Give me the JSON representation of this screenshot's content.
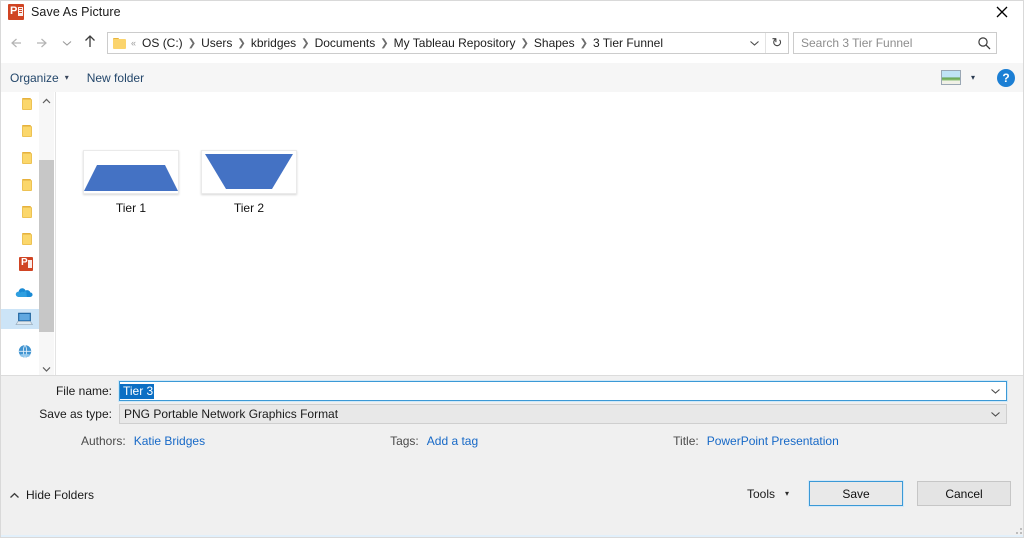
{
  "window": {
    "title": "Save As Picture",
    "app_icon": "powerpoint-icon",
    "close_label": "✕"
  },
  "nav": {
    "back_icon": "arrow-left-icon",
    "forward_icon": "arrow-right-icon",
    "recent_icon": "chevron-down-icon",
    "up_icon": "arrow-up-icon",
    "folder_icon": "folder-icon",
    "path_separator_small": "«",
    "breadcrumbs": [
      "OS (C:)",
      "Users",
      "kbridges",
      "Documents",
      "My Tableau Repository",
      "Shapes",
      "3 Tier Funnel"
    ],
    "breadcrumb_separator": "❯",
    "address_chevron_icon": "chevron-down-icon",
    "refresh_icon": "refresh-icon",
    "refresh_glyph": "↻"
  },
  "search": {
    "placeholder": "Search 3 Tier Funnel",
    "value": "",
    "icon": "search-icon"
  },
  "toolbar": {
    "organize_label": "Organize",
    "organize_caret": "▾",
    "new_folder_label": "New folder",
    "view_icon": "view-picture-icon",
    "view_caret": "▾",
    "help_label": "?"
  },
  "sidebar": {
    "scroll_up_icon": "chevron-up-icon",
    "scroll_down_icon": "chevron-down-icon",
    "items": [
      {
        "icon": "folder-icon",
        "name": "folder-item-1",
        "selected": false
      },
      {
        "icon": "folder-icon",
        "name": "folder-item-2",
        "selected": false
      },
      {
        "icon": "folder-icon",
        "name": "folder-item-3",
        "selected": false
      },
      {
        "icon": "folder-icon",
        "name": "folder-item-4",
        "selected": false
      },
      {
        "icon": "folder-icon",
        "name": "folder-item-5",
        "selected": false
      },
      {
        "icon": "folder-icon",
        "name": "folder-item-6",
        "selected": false
      },
      {
        "icon": "powerpoint-icon",
        "name": "powerpoint-item",
        "selected": false
      },
      {
        "icon": "onedrive-cloud-icon",
        "name": "onedrive-item",
        "selected": false
      },
      {
        "icon": "this-pc-icon",
        "name": "this-pc-item",
        "selected": true
      },
      {
        "icon": "network-globe-icon",
        "name": "network-item",
        "selected": false
      }
    ]
  },
  "files": [
    {
      "label": "Tier 1",
      "shape": "trapezoid",
      "color": "#4472C4",
      "top_inset_pct": 14,
      "top_y_pct": 34,
      "bottom_y_pct": 96
    },
    {
      "label": "Tier 2",
      "shape": "trapezoid",
      "color": "#4472C4",
      "top_inset_pct": 3,
      "top_y_pct": 9,
      "bottom_y_pct": 92
    }
  ],
  "form": {
    "file_name_label": "File name:",
    "file_name_value": "Tier 3",
    "file_name_chevron": "chevron-down-icon",
    "save_as_type_label": "Save as type:",
    "save_as_type_value": "PNG Portable Network Graphics Format",
    "save_as_type_chevron": "chevron-down-icon"
  },
  "metadata": {
    "authors_label": "Authors:",
    "authors_value": "Katie Bridges",
    "tags_label": "Tags:",
    "tags_value": "Add a tag",
    "title_label": "Title:",
    "title_value": "PowerPoint Presentation"
  },
  "footer": {
    "hide_folders_label": "Hide Folders",
    "hide_folders_icon": "chevron-up-icon",
    "tools_label": "Tools",
    "tools_caret": "▾",
    "save_label": "Save",
    "cancel_label": "Cancel"
  },
  "colors": {
    "accent_blue": "#0b6fc4",
    "link_blue": "#1769c7",
    "shape_blue": "#4472C4",
    "selection_blue": "#cce4f7",
    "powerpoint_orange": "#d04423"
  }
}
